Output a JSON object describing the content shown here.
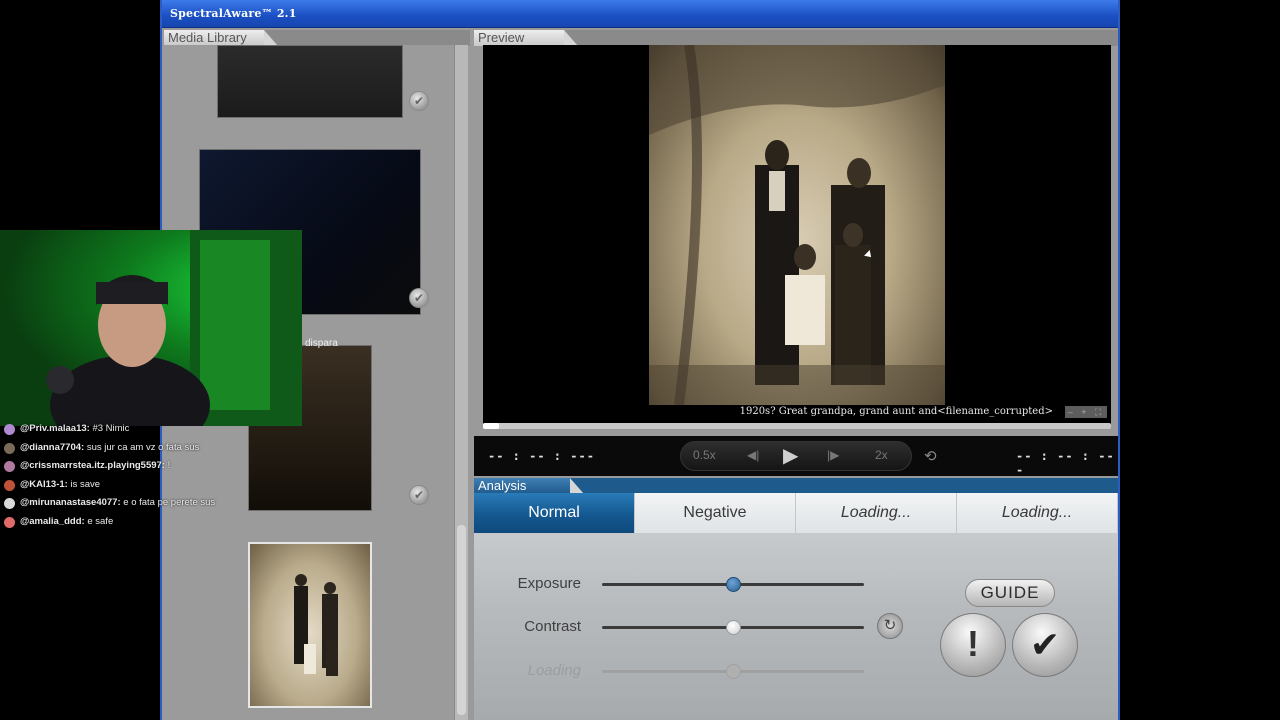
{
  "window": {
    "title": "SpectralAware™ 2.1"
  },
  "library": {
    "header": "Media Library",
    "items": [
      {
        "label": "library-item-1",
        "checked": true
      },
      {
        "label": "library-item-2",
        "checked": true
      },
      {
        "label": "library-item-3",
        "checked": true
      },
      {
        "label": "library-item-4",
        "checked": false
      }
    ]
  },
  "preview": {
    "header": "Preview",
    "caption": "1920s? Great grandpa, grand aunt and<filename_corrupted>",
    "window_buttons": "– + ⛶",
    "progress": 0.025
  },
  "transport": {
    "time_left": "-- : -- : ---",
    "time_right": "-- : -- : ---",
    "speed_slow": "0.5x",
    "speed_fast": "2x",
    "play_symbol": "▶",
    "prev_symbol": "◀|",
    "next_symbol": "|▶",
    "loop_symbol": "⟲"
  },
  "analysis": {
    "header": "Analysis",
    "tabs": [
      {
        "label": "Normal",
        "active": true
      },
      {
        "label": "Negative",
        "active": false
      },
      {
        "label": "Loading...",
        "active": false
      },
      {
        "label": "Loading...",
        "active": false
      }
    ],
    "sliders": [
      {
        "label": "Exposure",
        "value": 0.5,
        "knob": "blue"
      },
      {
        "label": "Contrast",
        "value": 0.5,
        "knob": "white"
      },
      {
        "label": "Loading",
        "value": 0.5,
        "knob": "faint"
      }
    ],
    "guide_label": "GUIDE",
    "alert_symbol": "!",
    "confirm_symbol": "✔",
    "reset_symbol": "↻"
  },
  "overlay": {
    "fragment": "dispara",
    "chat": [
      {
        "user": "@Priv.malaa13:",
        "text": "#3  Nimic",
        "color": "#b08ad0"
      },
      {
        "user": "@dianna7704:",
        "text": "sus jur ca am vz o fata sus",
        "color": "#7a6a5a"
      },
      {
        "user": "@crissmarrstea.itz.playing5597:",
        "text": "!",
        "color": "#b07aa0"
      },
      {
        "user": "@KAI13-1:",
        "text": "is save",
        "color": "#c0523a"
      },
      {
        "user": "@mirunanastase4077:",
        "text": "e o fata pe perete sus",
        "color": "#d9d9d9"
      },
      {
        "user": "@amalia_ddd:",
        "text": "e safe",
        "color": "#e06a6a"
      }
    ]
  }
}
